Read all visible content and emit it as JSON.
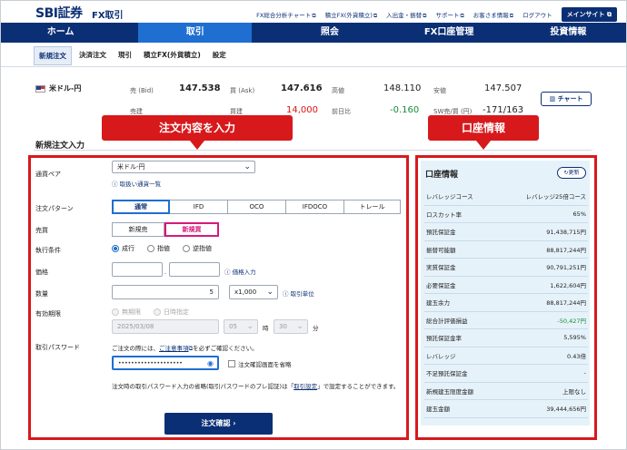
{
  "brand": {
    "logo": "SBI証券",
    "product": "FX取引"
  },
  "top_links": [
    "FX総合分析チャート",
    "積立FX(外貨積立)",
    "入出金・振替",
    "サポート",
    "お客さま情報",
    "ログアウト"
  ],
  "main_site": "メインサイト",
  "nav": [
    "ホーム",
    "取引",
    "照会",
    "FX口座管理",
    "投資情報"
  ],
  "subnav": [
    "新規注文",
    "決済注文",
    "現引",
    "積立FX(外貨積立)",
    "設定"
  ],
  "rates": {
    "pair": "米ドル-円",
    "bid_label": "売 (Bid)",
    "bid": "147.538",
    "ask_label": "買 (Ask)",
    "ask": "147.616",
    "high_label": "高値",
    "high": "148.110",
    "low_label": "安値",
    "low": "147.507",
    "row2_bid_label": "売建",
    "row2_bid": "",
    "row2_ask_label": "買建",
    "row2_ask": "14,000",
    "prev_label": "前日比",
    "prev": "-0.160",
    "sw_label": "SW売/買 (円)",
    "sw": "-171/163",
    "chart_button": "チャート"
  },
  "section_title": "新規注文入力",
  "callouts": {
    "order": "注文内容を入力",
    "account": "口座情報"
  },
  "form": {
    "pair_label": "通貨ペア",
    "pair_value": "米ドル-円",
    "pair_link": "取扱い通貨一覧",
    "pattern_label": "注文パターン",
    "patterns": [
      "通常",
      "IFD",
      "OCO",
      "IFDOCO",
      "トレール"
    ],
    "side_label": "売買",
    "sides": [
      "新規売",
      "新規買"
    ],
    "cond_label": "執行条件",
    "conds": [
      "成行",
      "指値",
      "逆指値"
    ],
    "price_label": "価格",
    "price_link": "価格入力",
    "qty_label": "数量",
    "qty_value": "5",
    "qty_unit": "x1,000",
    "qty_link": "取引単位",
    "expiry_label": "有効期限",
    "expiry_opts": [
      "無期限",
      "日時指定"
    ],
    "expiry_date": "2025/03/08",
    "expiry_hour": "05",
    "hour_unit": "時",
    "expiry_min": "30",
    "min_unit": "分",
    "pw_label": "取引パスワード",
    "pw_note_a": "ご注文の際には、",
    "pw_note_link": "ご注意事項",
    "pw_note_b": "を必ずご確認ください。",
    "pw_value": "••••••••••••••••••••",
    "skip_confirm": "注文確認画面を省略",
    "omit_note_a": "注文時の取引パスワード入力の省略(取引パスワードのプレ認証)は「",
    "omit_note_link": "取引設定",
    "omit_note_b": "」で設定することができます。",
    "confirm_button": "注文確認"
  },
  "account": {
    "title": "口座情報",
    "refresh": "更新",
    "rows": [
      {
        "k": "レバレッジコース",
        "v": "レバレッジ25倍コース"
      },
      {
        "k": "ロスカット率",
        "v": "65%"
      },
      {
        "k": "預託保証金",
        "v": "91,438,715円"
      },
      {
        "k": "振替可能額",
        "v": "88,817,244円"
      },
      {
        "k": "実質保証金",
        "v": "90,791,251円"
      },
      {
        "k": "必要保証金",
        "v": "1,622,604円"
      },
      {
        "k": "建玉余力",
        "v": "88,817,244円"
      },
      {
        "k": "総合計評価損益",
        "v": "-50,427円"
      },
      {
        "k": "預託保証金率",
        "v": "5,595%"
      },
      {
        "k": "レバレッジ",
        "v": "0.43倍"
      },
      {
        "k": "不足預託保証金",
        "v": "-"
      },
      {
        "k": "新規建玉限度金額",
        "v": "上限なし"
      },
      {
        "k": "建玉金額",
        "v": "39,444,656円"
      }
    ]
  },
  "colors": {
    "navy": "#0b2f74",
    "accent": "#1e6fd1",
    "callout_red": "#d7191c",
    "buy_pink": "#d7197a"
  }
}
